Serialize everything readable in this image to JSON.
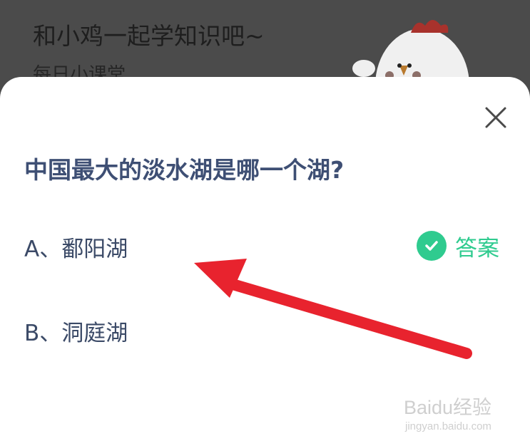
{
  "background": {
    "title": "和小鸡一起学知识吧~",
    "subtitle": "每日小课堂"
  },
  "quiz": {
    "question": "中国最大的淡水湖是哪一个湖?",
    "options": [
      {
        "label": "A、鄱阳湖",
        "is_answer": true
      },
      {
        "label": "B、洞庭湖",
        "is_answer": false
      }
    ],
    "answer_label": "答案"
  },
  "icons": {
    "close": "close-icon",
    "check": "check-circle-icon",
    "mascot": "chicken-mascot"
  },
  "colors": {
    "question": "#3e4f74",
    "answer_green": "#2fcb8f",
    "arrow_red": "#e8232e",
    "overlay": "#4b4b4b"
  },
  "watermark": {
    "brand": "Baidu经验",
    "url": "jingyan.baidu.com"
  }
}
